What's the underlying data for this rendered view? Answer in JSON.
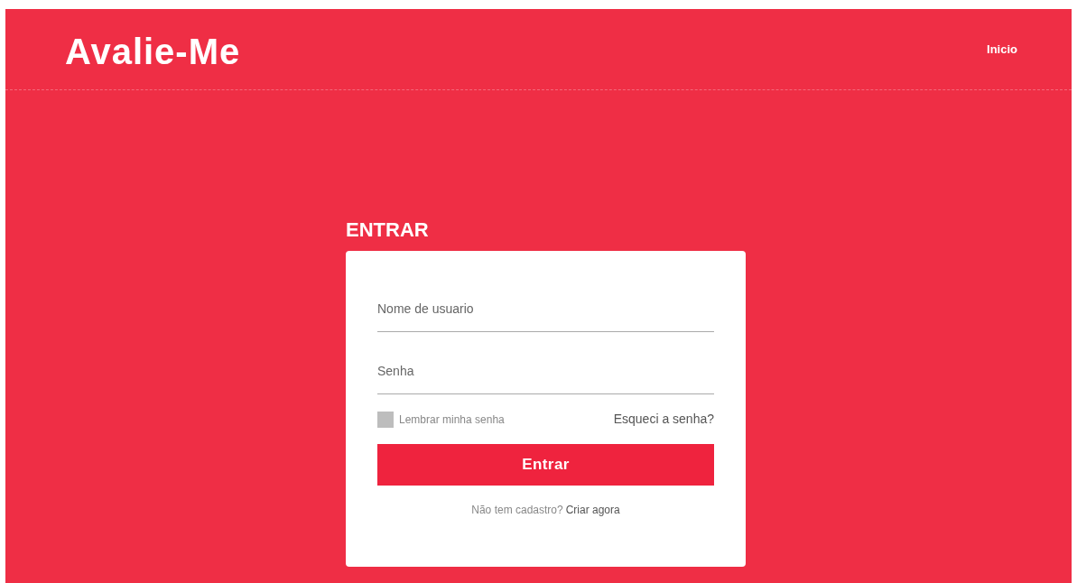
{
  "header": {
    "logo": "Avalie-Me",
    "nav": [
      {
        "label": "Inicio"
      }
    ]
  },
  "login": {
    "title": "ENTRAR",
    "fields": [
      {
        "placeholder": "Nome de usuario"
      },
      {
        "placeholder": "Senha"
      }
    ],
    "remember": {
      "label": "Lembrar minha senha",
      "checked": false
    },
    "forgot": "Esqueci a senha?",
    "submit": "Entrar",
    "signup_prompt": "Não tem cadastro?",
    "signup_link": "Criar agora"
  }
}
